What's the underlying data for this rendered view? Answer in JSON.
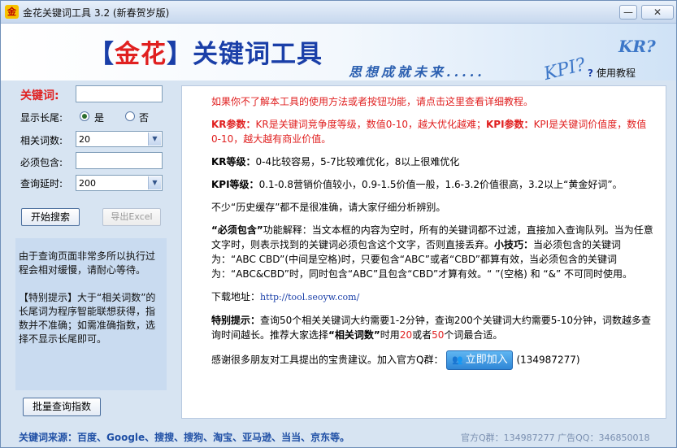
{
  "window": {
    "title": "金花关键词工具",
    "version": "3.2 (新春贺岁版)",
    "minimize": "—",
    "close": "✕"
  },
  "banner": {
    "title_open": "【",
    "title_brand": "金花",
    "title_close": "】",
    "title_rest": "关键词工具",
    "slogan": "思想成就未来.....",
    "kpi_text": "KPI?",
    "kr_text": "KR?",
    "help_icon": "?",
    "help_label": "使用教程"
  },
  "form": {
    "keyword_label": "关键词:",
    "keyword_value": "",
    "longtail_label": "显示长尾:",
    "radio_yes": "是",
    "radio_no": "否",
    "related_label": "相关词数:",
    "related_value": "20",
    "must_label": "必须包含:",
    "must_value": "",
    "delay_label": "查询延时:",
    "delay_value": "200",
    "start_button": "开始搜索",
    "export_button": "导出Excel"
  },
  "info": {
    "para1": "由于查询页面非常多所以执行过程会相对缓慢，请耐心等待。",
    "para2": "【特别提示】大于“相关词数”的长尾词为程序智能联想获得，指数并不准确；如需准确指数，选择不显示长尾即可。"
  },
  "batch_button": "批量查询指数",
  "content": {
    "intro": "如果你不了解本工具的使用方法或者按钮功能，请点击这里查看详细教程。",
    "kr_param_label": "KR参数：",
    "kr_param_text": "KR是关键词竞争度等级，数值0-10，越大优化越难；",
    "kpi_param_label": "KPI参数：",
    "kpi_param_text": "KPI是关键词价值度，数值0-10，越大越有商业价值。",
    "kr_level_label": "KR等级：",
    "kr_level_text": "0-4比较容易，5-7比较难优化，8以上很难优化",
    "kpi_level_label": "KPI等级：",
    "kpi_level_text": "0.1-0.8营销价值较小，0.9-1.5价值一般，1.6-3.2价值很高，3.2以上“黄金好词”。",
    "history_note": "不少“历史缓存”都不是很准确，请大家仔细分析辨别。",
    "must_title": "“必须包含”",
    "must_text": "功能解释：当文本框的内容为空时，所有的关键词都不过滤，直接加入查询队列。当为任意文字时，则表示找到的关键词必须包含这个文字，否则直接丢弃。",
    "tip_label": "小技巧：",
    "tip_text": "当必须包含的关键词为：“ABC CBD”(中间是空格)时，只要包含“ABC”或者“CBD”都算有效，当必须包含的关键词为：“ABC&CBD”时，同时包含“ABC”且包含“CBD”才算有效。“ ”(空格) 和 “&” 不可同时使用。",
    "download_label": "下载地址：",
    "download_url": "http://tool.seoyw.com/",
    "special_label": "特别提示：",
    "special_text1": "查询50个相关关键词大约需要1-2分钟，查询200个关键词大约需要5-10分钟，词数越多查询时间越长。推荐大家选择",
    "special_related": "“相关词数”",
    "special_text2": "时用",
    "special_n1": "20",
    "special_or": "或者",
    "special_n2": "50",
    "special_text3": "个词最合适。",
    "thanks_text": "感谢很多朋友对工具提出的宝贵建议。加入官方Q群：",
    "join_icon": "👥",
    "join_button": "立即加入",
    "qq_group": "(134987277)"
  },
  "footer": {
    "sources": "关键词来源：百度、Google、搜搜、搜狗、淘宝、亚马逊、当当、京东等。",
    "contact": "官方Q群：134987277 广告QQ：346850018"
  }
}
